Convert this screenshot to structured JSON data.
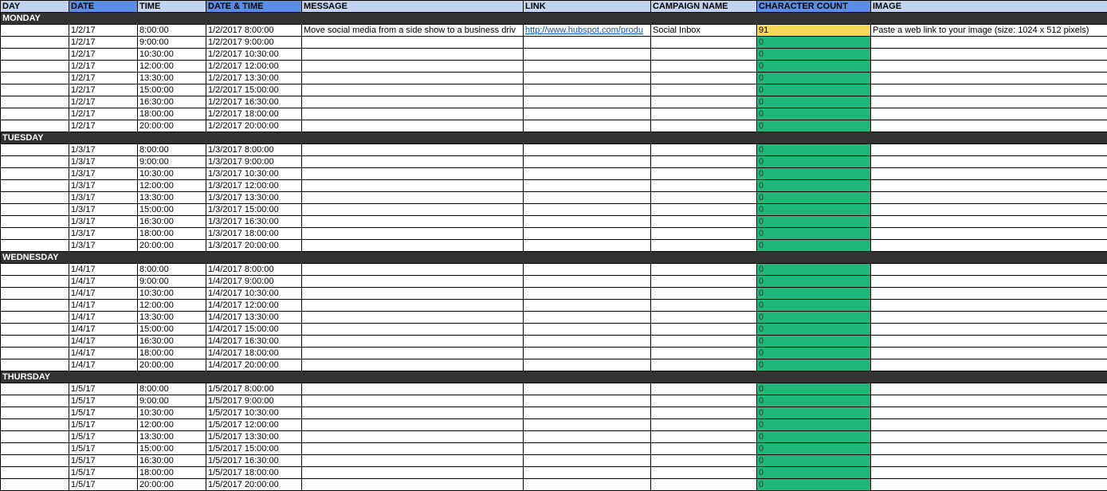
{
  "headers": {
    "day": "DAY",
    "date": "DATE",
    "time": "TIME",
    "datetime": "DATE & TIME",
    "message": "MESSAGE",
    "link": "LINK",
    "campaign": "CAMPAIGN NAME",
    "char_count": "CHARACTER COUNT",
    "image": "IMAGE"
  },
  "days": [
    {
      "name": "MONDAY",
      "rows": [
        {
          "date": "1/2/17",
          "time": "8:00:00",
          "datetime": "1/2/2017 8:00:00",
          "message": "Move social media from a side show to a business driv",
          "link": "http://www.hubspot.com/produ",
          "campaign": "Social Inbox",
          "cc": "91",
          "cc_color": "yellow",
          "image": "Paste a web link to your image (size: 1024 x 512 pixels)"
        },
        {
          "date": "1/2/17",
          "time": "9:00:00",
          "datetime": "1/2/2017 9:00:00",
          "message": "",
          "link": "",
          "campaign": "",
          "cc": "0",
          "cc_color": "green",
          "image": ""
        },
        {
          "date": "1/2/17",
          "time": "10:30:00",
          "datetime": "1/2/2017 10:30:00",
          "message": "",
          "link": "",
          "campaign": "",
          "cc": "0",
          "cc_color": "green",
          "image": ""
        },
        {
          "date": "1/2/17",
          "time": "12:00:00",
          "datetime": "1/2/2017 12:00:00",
          "message": "",
          "link": "",
          "campaign": "",
          "cc": "0",
          "cc_color": "green",
          "image": ""
        },
        {
          "date": "1/2/17",
          "time": "13:30:00",
          "datetime": "1/2/2017 13:30:00",
          "message": "",
          "link": "",
          "campaign": "",
          "cc": "0",
          "cc_color": "green",
          "image": ""
        },
        {
          "date": "1/2/17",
          "time": "15:00:00",
          "datetime": "1/2/2017 15:00:00",
          "message": "",
          "link": "",
          "campaign": "",
          "cc": "0",
          "cc_color": "green",
          "image": ""
        },
        {
          "date": "1/2/17",
          "time": "16:30:00",
          "datetime": "1/2/2017 16:30:00",
          "message": "",
          "link": "",
          "campaign": "",
          "cc": "0",
          "cc_color": "green",
          "image": ""
        },
        {
          "date": "1/2/17",
          "time": "18:00:00",
          "datetime": "1/2/2017 18:00:00",
          "message": "",
          "link": "",
          "campaign": "",
          "cc": "0",
          "cc_color": "green",
          "image": ""
        },
        {
          "date": "1/2/17",
          "time": "20:00:00",
          "datetime": "1/2/2017 20:00:00",
          "message": "",
          "link": "",
          "campaign": "",
          "cc": "0",
          "cc_color": "green",
          "image": ""
        }
      ]
    },
    {
      "name": "TUESDAY",
      "rows": [
        {
          "date": "1/3/17",
          "time": "8:00:00",
          "datetime": "1/3/2017 8:00:00",
          "message": "",
          "link": "",
          "campaign": "",
          "cc": "0",
          "cc_color": "green",
          "image": ""
        },
        {
          "date": "1/3/17",
          "time": "9:00:00",
          "datetime": "1/3/2017 9:00:00",
          "message": "",
          "link": "",
          "campaign": "",
          "cc": "0",
          "cc_color": "green",
          "image": ""
        },
        {
          "date": "1/3/17",
          "time": "10:30:00",
          "datetime": "1/3/2017 10:30:00",
          "message": "",
          "link": "",
          "campaign": "",
          "cc": "0",
          "cc_color": "green",
          "image": ""
        },
        {
          "date": "1/3/17",
          "time": "12:00:00",
          "datetime": "1/3/2017 12:00:00",
          "message": "",
          "link": "",
          "campaign": "",
          "cc": "0",
          "cc_color": "green",
          "image": ""
        },
        {
          "date": "1/3/17",
          "time": "13:30:00",
          "datetime": "1/3/2017 13:30:00",
          "message": "",
          "link": "",
          "campaign": "",
          "cc": "0",
          "cc_color": "green",
          "image": ""
        },
        {
          "date": "1/3/17",
          "time": "15:00:00",
          "datetime": "1/3/2017 15:00:00",
          "message": "",
          "link": "",
          "campaign": "",
          "cc": "0",
          "cc_color": "green",
          "image": ""
        },
        {
          "date": "1/3/17",
          "time": "16:30:00",
          "datetime": "1/3/2017 16:30:00",
          "message": "",
          "link": "",
          "campaign": "",
          "cc": "0",
          "cc_color": "green",
          "image": ""
        },
        {
          "date": "1/3/17",
          "time": "18:00:00",
          "datetime": "1/3/2017 18:00:00",
          "message": "",
          "link": "",
          "campaign": "",
          "cc": "0",
          "cc_color": "green",
          "image": ""
        },
        {
          "date": "1/3/17",
          "time": "20:00:00",
          "datetime": "1/3/2017 20:00:00",
          "message": "",
          "link": "",
          "campaign": "",
          "cc": "0",
          "cc_color": "green",
          "image": ""
        }
      ]
    },
    {
      "name": "WEDNESDAY",
      "rows": [
        {
          "date": "1/4/17",
          "time": "8:00:00",
          "datetime": "1/4/2017 8:00:00",
          "message": "",
          "link": "",
          "campaign": "",
          "cc": "0",
          "cc_color": "green",
          "image": ""
        },
        {
          "date": "1/4/17",
          "time": "9:00:00",
          "datetime": "1/4/2017 9:00:00",
          "message": "",
          "link": "",
          "campaign": "",
          "cc": "0",
          "cc_color": "green",
          "image": ""
        },
        {
          "date": "1/4/17",
          "time": "10:30:00",
          "datetime": "1/4/2017 10:30:00",
          "message": "",
          "link": "",
          "campaign": "",
          "cc": "0",
          "cc_color": "green",
          "image": ""
        },
        {
          "date": "1/4/17",
          "time": "12:00:00",
          "datetime": "1/4/2017 12:00:00",
          "message": "",
          "link": "",
          "campaign": "",
          "cc": "0",
          "cc_color": "green",
          "image": ""
        },
        {
          "date": "1/4/17",
          "time": "13:30:00",
          "datetime": "1/4/2017 13:30:00",
          "message": "",
          "link": "",
          "campaign": "",
          "cc": "0",
          "cc_color": "green",
          "image": ""
        },
        {
          "date": "1/4/17",
          "time": "15:00:00",
          "datetime": "1/4/2017 15:00:00",
          "message": "",
          "link": "",
          "campaign": "",
          "cc": "0",
          "cc_color": "green",
          "image": ""
        },
        {
          "date": "1/4/17",
          "time": "16:30:00",
          "datetime": "1/4/2017 16:30:00",
          "message": "",
          "link": "",
          "campaign": "",
          "cc": "0",
          "cc_color": "green",
          "image": ""
        },
        {
          "date": "1/4/17",
          "time": "18:00:00",
          "datetime": "1/4/2017 18:00:00",
          "message": "",
          "link": "",
          "campaign": "",
          "cc": "0",
          "cc_color": "green",
          "image": ""
        },
        {
          "date": "1/4/17",
          "time": "20:00:00",
          "datetime": "1/4/2017 20:00:00",
          "message": "",
          "link": "",
          "campaign": "",
          "cc": "0",
          "cc_color": "green",
          "image": ""
        }
      ]
    },
    {
      "name": "THURSDAY",
      "rows": [
        {
          "date": "1/5/17",
          "time": "8:00:00",
          "datetime": "1/5/2017 8:00:00",
          "message": "",
          "link": "",
          "campaign": "",
          "cc": "0",
          "cc_color": "green",
          "image": ""
        },
        {
          "date": "1/5/17",
          "time": "9:00:00",
          "datetime": "1/5/2017 9:00:00",
          "message": "",
          "link": "",
          "campaign": "",
          "cc": "0",
          "cc_color": "green",
          "image": ""
        },
        {
          "date": "1/5/17",
          "time": "10:30:00",
          "datetime": "1/5/2017 10:30:00",
          "message": "",
          "link": "",
          "campaign": "",
          "cc": "0",
          "cc_color": "green",
          "image": ""
        },
        {
          "date": "1/5/17",
          "time": "12:00:00",
          "datetime": "1/5/2017 12:00:00",
          "message": "",
          "link": "",
          "campaign": "",
          "cc": "0",
          "cc_color": "green",
          "image": ""
        },
        {
          "date": "1/5/17",
          "time": "13:30:00",
          "datetime": "1/5/2017 13:30:00",
          "message": "",
          "link": "",
          "campaign": "",
          "cc": "0",
          "cc_color": "green",
          "image": ""
        },
        {
          "date": "1/5/17",
          "time": "15:00:00",
          "datetime": "1/5/2017 15:00:00",
          "message": "",
          "link": "",
          "campaign": "",
          "cc": "0",
          "cc_color": "green",
          "image": ""
        },
        {
          "date": "1/5/17",
          "time": "16:30:00",
          "datetime": "1/5/2017 16:30:00",
          "message": "",
          "link": "",
          "campaign": "",
          "cc": "0",
          "cc_color": "green",
          "image": ""
        },
        {
          "date": "1/5/17",
          "time": "18:00:00",
          "datetime": "1/5/2017 18:00:00",
          "message": "",
          "link": "",
          "campaign": "",
          "cc": "0",
          "cc_color": "green",
          "image": ""
        },
        {
          "date": "1/5/17",
          "time": "20:00:00",
          "datetime": "1/5/2017 20:00:00",
          "message": "",
          "link": "",
          "campaign": "",
          "cc": "0",
          "cc_color": "green",
          "image": ""
        }
      ]
    }
  ]
}
